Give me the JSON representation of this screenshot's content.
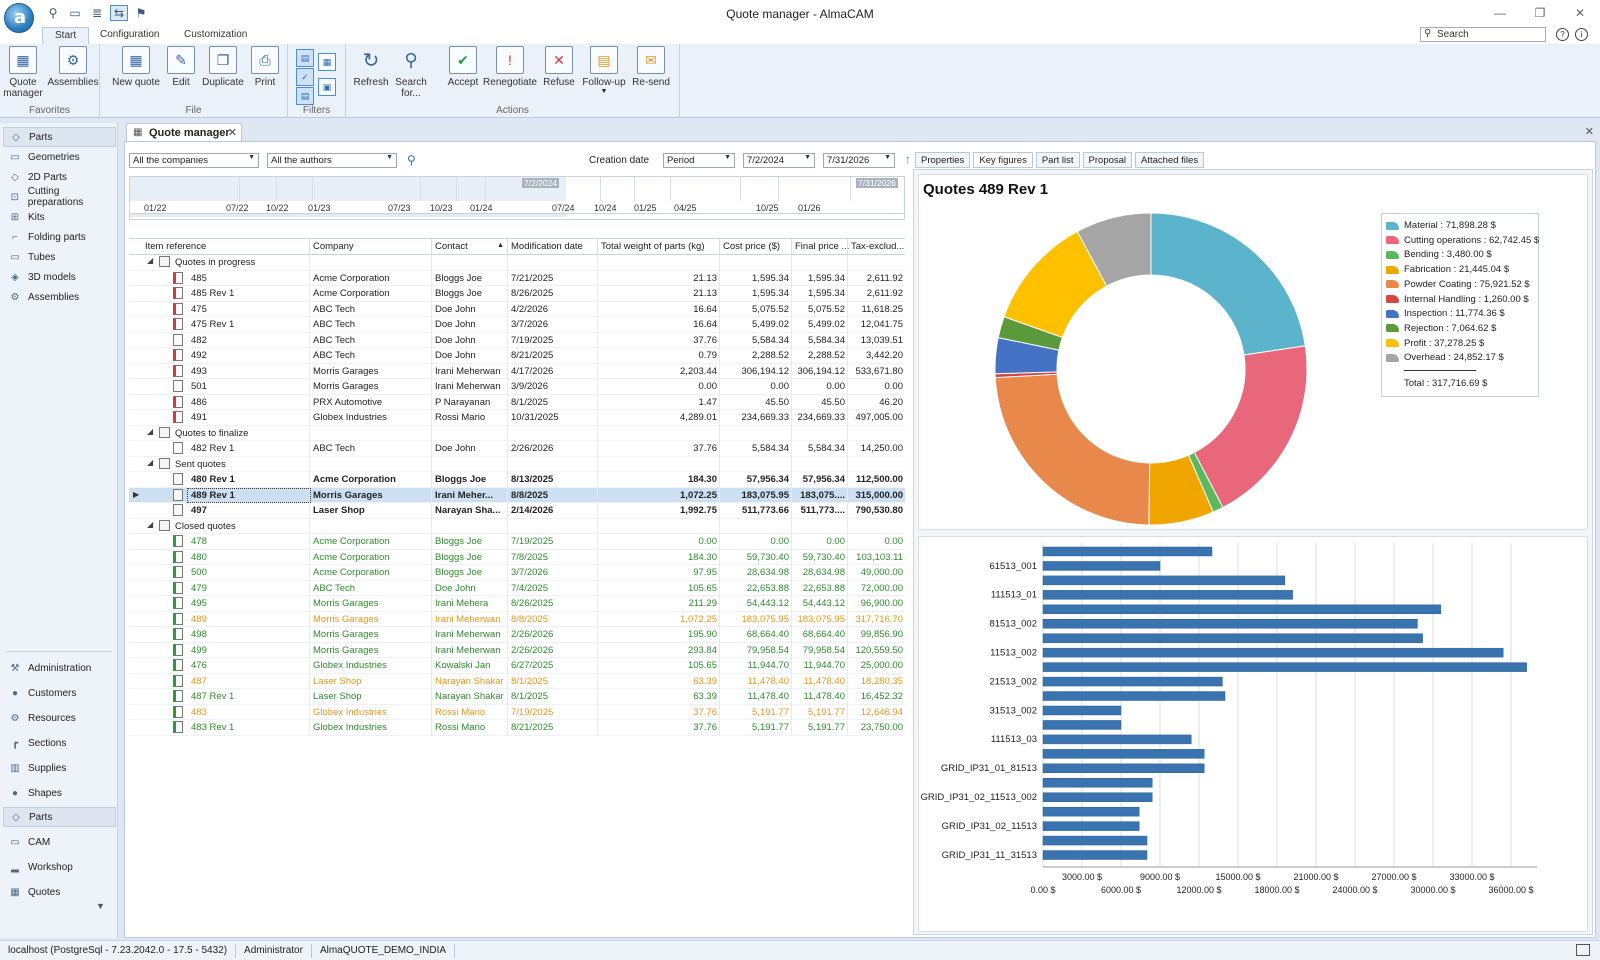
{
  "window": {
    "title": "Quote manager - AlmaCAM"
  },
  "ribbon_tabs": [
    "Start",
    "Configuration",
    "Customization"
  ],
  "search": {
    "placeholder": "Search"
  },
  "ribbon": {
    "groups": [
      {
        "label": "Favorites",
        "buttons": [
          "Quote manager",
          "Assemblies"
        ]
      },
      {
        "label": "File",
        "buttons": [
          "New quote",
          "Edit",
          "Duplicate",
          "Print"
        ]
      },
      {
        "label": "Filters",
        "buttons": []
      },
      {
        "label": "Actions",
        "buttons": [
          "Refresh",
          "Search for...",
          "Accept",
          "Renegotiate",
          "Refuse",
          "Follow-up",
          "Re-send"
        ]
      }
    ]
  },
  "leftnav": {
    "header": "Parts",
    "top_items": [
      "Geometries",
      "2D Parts",
      "Cutting preparations",
      "Kits",
      "Folding parts",
      "Tubes",
      "3D models",
      "Assemblies"
    ],
    "bottom_items": [
      "Administration",
      "Customers",
      "Resources",
      "Sections",
      "Supplies",
      "Shapes",
      "Parts",
      "CAM",
      "Workshop",
      "Quotes"
    ]
  },
  "doc_tab": {
    "title": "Quote manager"
  },
  "filters": {
    "companies": "All the companies",
    "authors": "All the authors",
    "creation_label": "Creation date",
    "period": "Period",
    "date_from": "7/2/2024",
    "date_to": "7/31/2026"
  },
  "timeline": {
    "labels": [
      "01/22",
      "07/22",
      "10/22",
      "01/23",
      "07/23",
      "10/23",
      "01/24",
      "07/24",
      "10/24",
      "01/25",
      "04/25",
      "10/25",
      "01/26"
    ],
    "flag_left": "7/2/2024",
    "flag_right": "7/31/2026"
  },
  "grid": {
    "columns": [
      "Item reference",
      "Company",
      "Contact",
      "Modification date",
      "Total weight of parts (kg)",
      "Cost price ($)",
      "Final price ...",
      "Tax-exclud..."
    ],
    "groups": [
      {
        "label": "Quotes in progress",
        "rows": [
          [
            "485",
            "Acme Corporation",
            "Bloggs Joe",
            "7/21/2025",
            "21.13",
            "1,595.34",
            "1,595.34",
            "2,611.92",
            "red",
            ""
          ],
          [
            "485 Rev 1",
            "Acme Corporation",
            "Bloggs Joe",
            "8/26/2025",
            "21.13",
            "1,595.34",
            "1,595.34",
            "2,611.92",
            "red",
            ""
          ],
          [
            "475",
            "ABC Tech",
            "Doe John",
            "4/2/2026",
            "16.64",
            "5,075.52",
            "5,075.52",
            "11,618.25",
            "red",
            ""
          ],
          [
            "475 Rev 1",
            "ABC Tech",
            "Doe John",
            "3/7/2026",
            "16.64",
            "5,499.02",
            "5,499.02",
            "12,041.75",
            "red",
            ""
          ],
          [
            "482",
            "ABC Tech",
            "Doe John",
            "7/19/2025",
            "37.76",
            "5,584.34",
            "5,584.34",
            "13,039.51",
            "",
            ""
          ],
          [
            "492",
            "ABC Tech",
            "Doe John",
            "8/21/2025",
            "0.79",
            "2,288.52",
            "2,288.52",
            "3,442.20",
            "red",
            ""
          ],
          [
            "493",
            "Morris Garages",
            "Irani Meherwan",
            "4/17/2026",
            "2,203.44",
            "306,194.12",
            "306,194.12",
            "533,671.80",
            "red",
            ""
          ],
          [
            "501",
            "Morris Garages",
            "Irani Meherwan",
            "3/9/2026",
            "0.00",
            "0.00",
            "0.00",
            "0.00",
            "",
            ""
          ],
          [
            "486",
            "PRX Automotive",
            "P Narayanan",
            "8/1/2025",
            "1.47",
            "45.50",
            "45.50",
            "46.20",
            "red",
            ""
          ],
          [
            "491",
            "Globex Industries",
            "Rossi Mario",
            "10/31/2025",
            "4,289.01",
            "234,669.33",
            "234,669.33",
            "497,005.00",
            "red",
            ""
          ]
        ]
      },
      {
        "label": "Quotes to finalize",
        "rows": [
          [
            "482 Rev 1",
            "ABC Tech",
            "Doe John",
            "2/26/2026",
            "37.76",
            "5,584.34",
            "5,584.34",
            "14,250.00",
            "",
            ""
          ]
        ]
      },
      {
        "label": "Sent quotes",
        "rows": [
          [
            "480 Rev 1",
            "Acme Corporation",
            "Bloggs Joe",
            "8/13/2025",
            "184.30",
            "57,956.34",
            "57,956.34",
            "112,500.00",
            "",
            "bold"
          ],
          [
            "489 Rev 1",
            "Morris Garages",
            "Irani Meher...",
            "8/8/2025",
            "1,072.25",
            "183,075.95",
            "183,075....",
            "315,000.00",
            "",
            "bold selected"
          ],
          [
            "497",
            "Laser Shop",
            "Narayan Sha...",
            "2/14/2026",
            "1,992.75",
            "511,773.66",
            "511,773....",
            "790,530.80",
            "",
            "bold"
          ]
        ]
      },
      {
        "label": "Closed quotes",
        "rows": [
          [
            "478",
            "Acme Corporation",
            "Bloggs Joe",
            "7/19/2025",
            "0.00",
            "0.00",
            "0.00",
            "0.00",
            "",
            "green"
          ],
          [
            "480",
            "Acme Corporation",
            "Bloggs Joe",
            "7/8/2025",
            "184.30",
            "59,730.40",
            "59,730.40",
            "103,103.11",
            "",
            "green"
          ],
          [
            "500",
            "Acme Corporation",
            "Bloggs Joe",
            "3/7/2026",
            "97.95",
            "28,634.98",
            "28,634.98",
            "49,000.00",
            "",
            "green"
          ],
          [
            "479",
            "ABC Tech",
            "Doe John",
            "7/4/2025",
            "105.65",
            "22,653.88",
            "22,653.88",
            "72,000.00",
            "",
            "green"
          ],
          [
            "495",
            "Morris Garages",
            "Irani Mehera",
            "8/26/2025",
            "211.29",
            "54,443.12",
            "54,443.12",
            "96,900.00",
            "",
            "green"
          ],
          [
            "489",
            "Morris Garages",
            "Irani Meherwan",
            "8/8/2025",
            "1,072.25",
            "183,075.95",
            "183,075.95",
            "317,716.70",
            "",
            "orange"
          ],
          [
            "498",
            "Morris Garages",
            "Irani Meherwan",
            "2/26/2026",
            "195.90",
            "68,664.40",
            "68,664.40",
            "99,856.90",
            "",
            "green"
          ],
          [
            "499",
            "Morris Garages",
            "Irani Meherwan",
            "2/26/2026",
            "293.84",
            "79,958.54",
            "79,958.54",
            "120,559.50",
            "",
            "green"
          ],
          [
            "476",
            "Globex Industries",
            "Kowalski Jan",
            "6/27/2025",
            "105.65",
            "11,944.70",
            "11,944.70",
            "25,000.00",
            "",
            "green"
          ],
          [
            "487",
            "Laser Shop",
            "Narayan Shakar",
            "8/1/2025",
            "63.39",
            "11,478.40",
            "11,478.40",
            "18,280.35",
            "",
            "orange"
          ],
          [
            "487 Rev 1",
            "Laser Shop",
            "Narayan Shakar",
            "8/1/2025",
            "63.39",
            "11,478.40",
            "11,478.40",
            "16,452.32",
            "",
            "green"
          ],
          [
            "483",
            "Globex Industries",
            "Rossi Mario",
            "7/19/2025",
            "37.76",
            "5,191.77",
            "5,191.77",
            "12,646.94",
            "",
            "orange"
          ],
          [
            "483 Rev 1",
            "Globex Industries",
            "Rossi Mario",
            "8/21/2025",
            "37.76",
            "5,191.77",
            "5,191.77",
            "23,750.00",
            "",
            "green"
          ]
        ]
      }
    ]
  },
  "right_tabs": [
    "Properties",
    "Key figures",
    "Part list",
    "Proposal",
    "Attached files"
  ],
  "chart_data": [
    {
      "type": "pie",
      "title": "Quotes 489 Rev 1",
      "legend_placement": "right",
      "slices": [
        {
          "name": "Material : 71,898.28 $",
          "value": 71898.28,
          "color": "#5cb3cc"
        },
        {
          "name": "Cutting operations : 62,742.45 $",
          "value": 62742.45,
          "color": "#e8677b"
        },
        {
          "name": "Bending : 3,480.00 $",
          "value": 3480.0,
          "color": "#5cb85c"
        },
        {
          "name": "Fabrication : 21,445.04 $",
          "value": 21445.04,
          "color": "#f0a500"
        },
        {
          "name": "Powder Coating : 75,921.52 $",
          "value": 75921.52,
          "color": "#e8884a"
        },
        {
          "name": "Internal Handling : 1,260.00 $",
          "value": 1260.0,
          "color": "#d64545"
        },
        {
          "name": "Inspection : 11,774.36 $",
          "value": 11774.36,
          "color": "#4472c4"
        },
        {
          "name": "Rejection : 7,064.62 $",
          "value": 7064.62,
          "color": "#5a9a3a"
        },
        {
          "name": "Profit : 37,278.25 $",
          "value": 37278.25,
          "color": "#ffc000"
        },
        {
          "name": "Overhead : 24,852.17 $",
          "value": 24852.17,
          "color": "#a5a5a5"
        }
      ],
      "total": "Total : 317,716.69 $"
    },
    {
      "type": "bar",
      "orientation": "horizontal",
      "category_labels": [
        "61513_001",
        "111513_01",
        "81513_002",
        "11513_002",
        "21513_002",
        "31513_002",
        "111513_03",
        "GRID_IP31_01_81513",
        "GRID_IP31_02_11513_002",
        "GRID_IP31_02_11513",
        "GRID_IP31_11_31513"
      ],
      "values": [
        13000,
        9000,
        18600,
        19200,
        30600,
        28800,
        29200,
        35400,
        37200,
        13800,
        14000,
        6000,
        6000,
        11400,
        12400,
        12400,
        8400,
        8400,
        7400,
        7400,
        8000,
        8000
      ],
      "xlim": [
        0,
        38000
      ],
      "x_ticks_upper": [
        "3000.00 $",
        "9000.00 $",
        "15000.00 $",
        "21000.00 $",
        "27000.00 $",
        "33000.00 $"
      ],
      "x_ticks_lower": [
        "0.00 $",
        "6000.00 $",
        "12000.00 $",
        "18000.00 $",
        "24000.00 $",
        "30000.00 $",
        "36000.00 $"
      ],
      "color": "#3a74b0",
      "grid": true
    }
  ],
  "statusbar": [
    "localhost (PostgreSql - 7.23.2042.0 - 17.5 - 5432)",
    "Administrator",
    "AlmaQUOTE_DEMO_INDIA"
  ]
}
